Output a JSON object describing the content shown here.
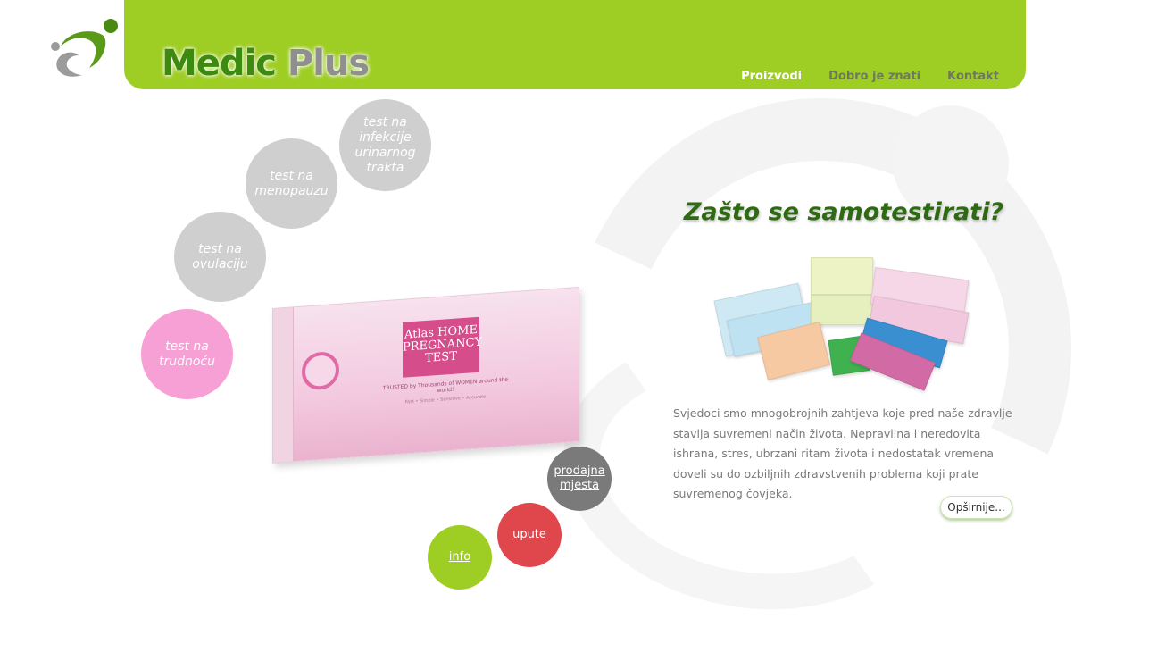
{
  "brand": {
    "part1": "Medic",
    "part2": " Plus"
  },
  "nav": {
    "items": [
      {
        "label": "Proizvodi",
        "active": true
      },
      {
        "label": "Dobro je znati",
        "active": false
      },
      {
        "label": "Kontakt",
        "active": false
      }
    ]
  },
  "categories": {
    "uti": "test na infekcije urinarnog trakta",
    "menopause": "test na menopauzu",
    "ovulation": "test na ovulaciju",
    "pregnancy": "test na trudnoću"
  },
  "actions": {
    "sales": "prodajna mjesta",
    "instructions": "upute",
    "info": "info"
  },
  "main": {
    "heading": "Zašto se samotestirati?",
    "description": "Svjedoci smo mnogobrojnih zahtjeva koje pred naše zdravlje stavlja suvremeni način života. Nepravilna i neredovita ishrana, stres, ubrzani ritam života i nedostatak vremena doveli su do ozbiljnih zdravstvenih problema koji prate suvremenog čovjeka.",
    "more_button": "Opširnije..."
  },
  "colors": {
    "header_green": "#9ecd24",
    "pink": "#f7a0d6",
    "grey": "#cfcfcf",
    "red": "#e0474d",
    "dark_grey": "#7a7a7a",
    "heading_green": "#2e6a12"
  },
  "product": {
    "brand_line1": "Atlas HOME",
    "brand_line2": "PREGNANCY",
    "brand_line3": "TEST",
    "tagline": "TRUSTED by Thousands of WOMEN around the world!",
    "features": "Fast • Simple • Sensitive • Accurate"
  }
}
